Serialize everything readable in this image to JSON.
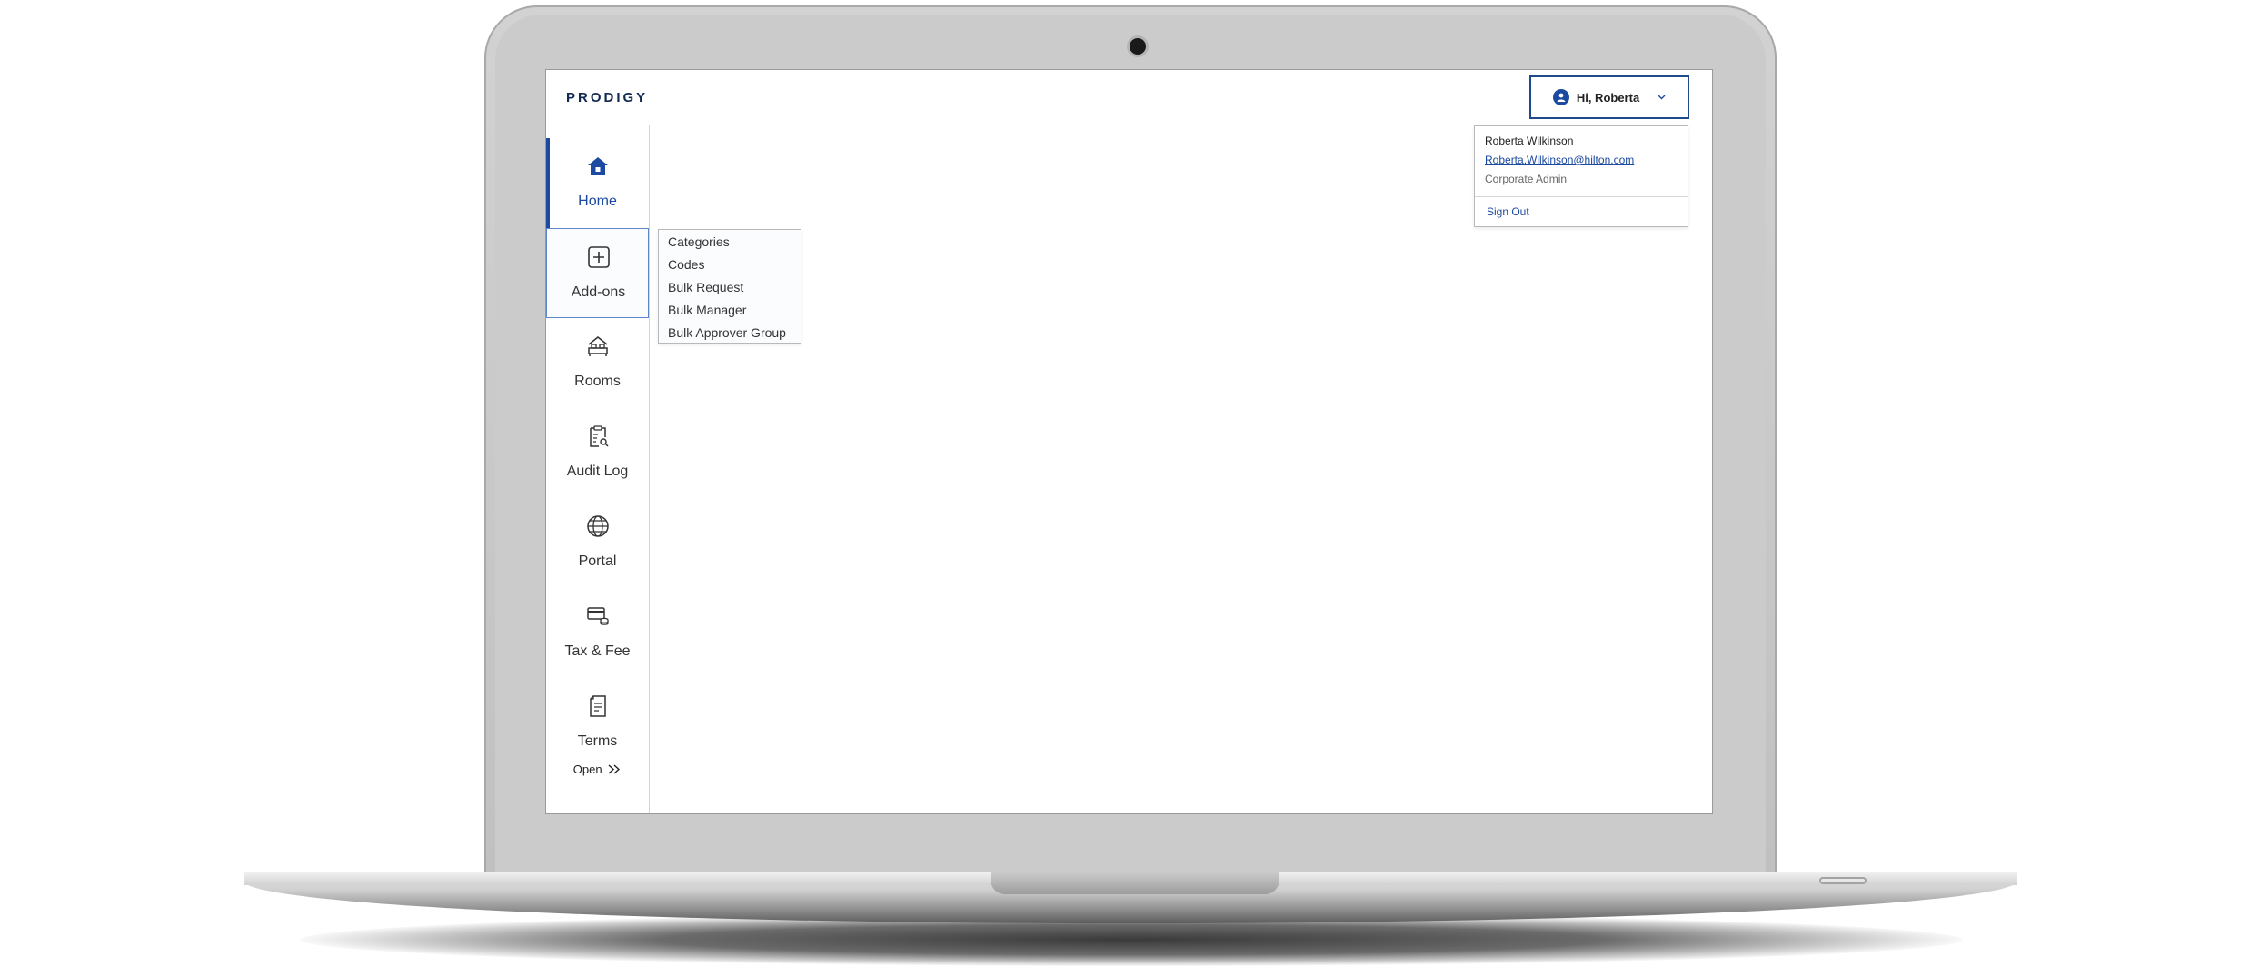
{
  "app": {
    "logo_text": "PRODIGY"
  },
  "header": {
    "greeting": "Hi, Roberta",
    "avatar_icon": "user-icon",
    "chevron_icon": "chevron-down-icon"
  },
  "user_menu": {
    "name": "Roberta Wilkinson",
    "email": "Roberta.Wilkinson@hilton.com",
    "role": "Corporate Admin",
    "sign_out": "Sign Out"
  },
  "sidebar": {
    "items": [
      {
        "label": "Home",
        "icon": "home-icon",
        "state": "active"
      },
      {
        "label": "Add-ons",
        "icon": "plus-square-icon",
        "state": "hover"
      },
      {
        "label": "Rooms",
        "icon": "bed-icon",
        "state": ""
      },
      {
        "label": "Audit Log",
        "icon": "clipboard-search-icon",
        "state": ""
      },
      {
        "label": "Portal",
        "icon": "globe-icon",
        "state": ""
      },
      {
        "label": "Tax & Fee",
        "icon": "card-coins-icon",
        "state": ""
      },
      {
        "label": "Terms",
        "icon": "document-icon",
        "state": ""
      }
    ],
    "open_label": "Open",
    "open_icon": "double-chevron-right-icon"
  },
  "addons_submenu": {
    "items": [
      "Categories",
      "Codes",
      "Bulk Request",
      "Bulk Manager",
      "Bulk Approver Group"
    ]
  },
  "colors": {
    "accent": "#1c4aa0",
    "logo": "#102a51",
    "border": "#b9b9b9"
  }
}
